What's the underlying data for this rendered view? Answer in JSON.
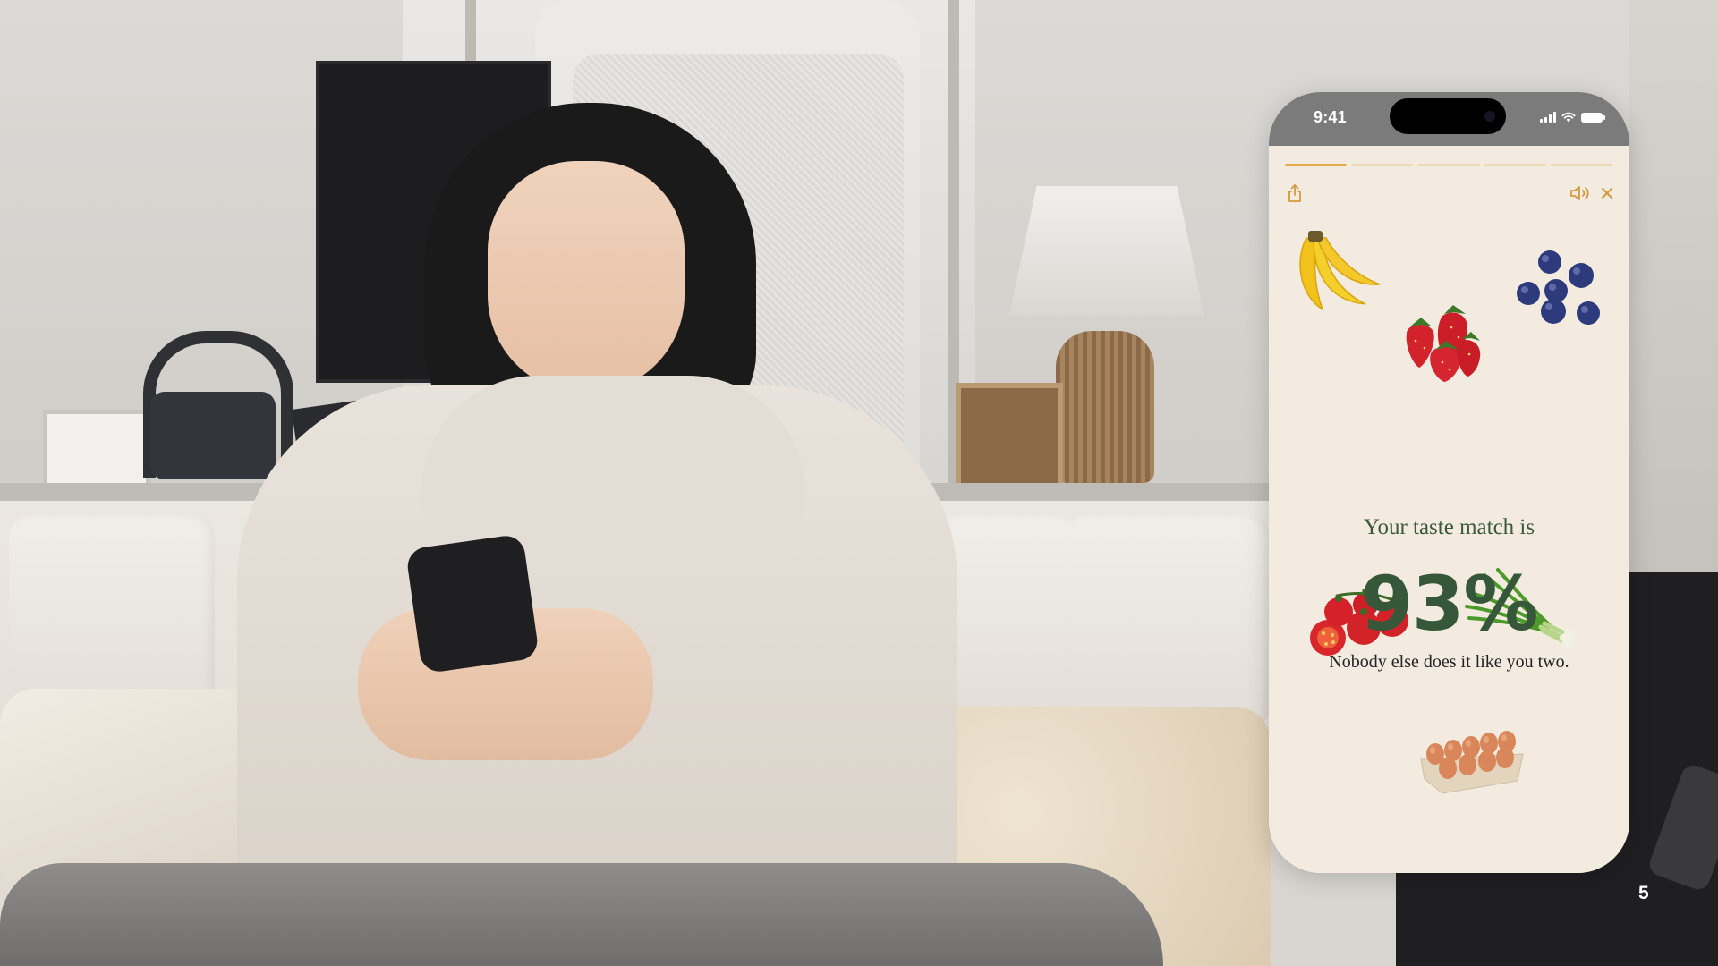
{
  "status_bar": {
    "time": "9:41"
  },
  "story": {
    "segments_total": 5,
    "segments_active": 1
  },
  "result": {
    "title": "Your taste match is",
    "percent": "93%",
    "subtitle": "Nobody else does it like you two."
  },
  "foods": [
    "banana-icon",
    "blueberries-icon",
    "strawberries-icon",
    "tomatoes-icon",
    "green-onion-icon",
    "eggs-icon"
  ],
  "colors": {
    "accent": "#e4aa4d",
    "green": "#37573a",
    "background": "#f3ebe0"
  },
  "page_number": "5"
}
